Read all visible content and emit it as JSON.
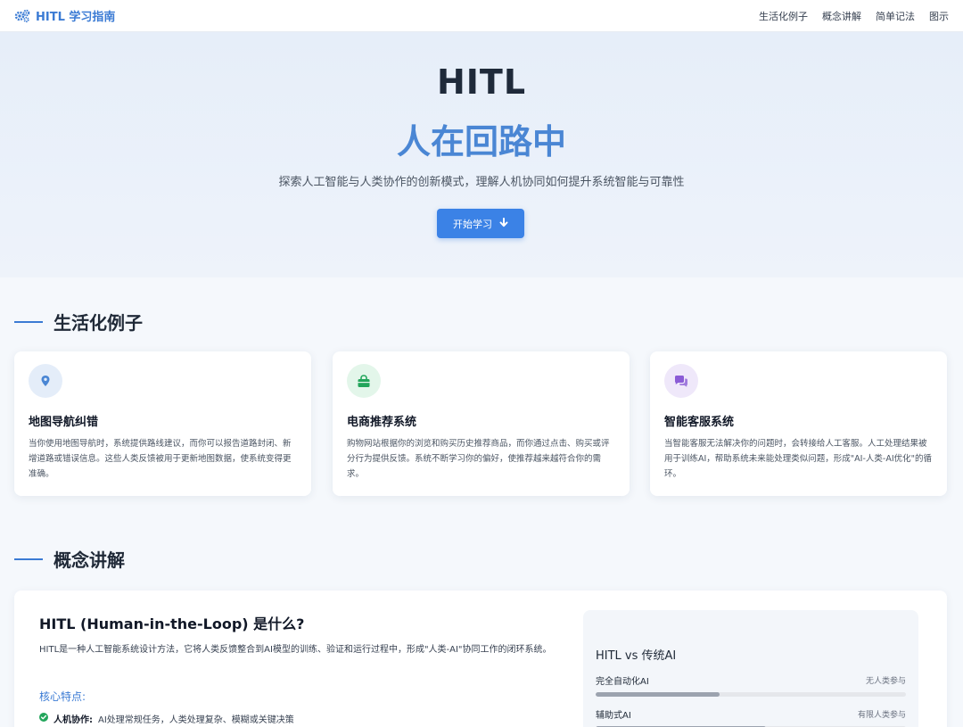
{
  "nav": {
    "brand": "HITL 学习指南",
    "links": [
      "生活化例子",
      "概念讲解",
      "简单记法",
      "图示"
    ]
  },
  "hero": {
    "title": "HITL",
    "subtitle": "人在回路中",
    "description": "探索人工智能与人类协作的创新模式，理解人机协同如何提升系统智能与可靠性",
    "button": "开始学习"
  },
  "examples": {
    "heading": "生活化例子",
    "cards": [
      {
        "icon": "map-pin-icon",
        "icon_color": "#4a86d4",
        "icon_bg": "#e4edf9",
        "title": "地图导航纠错",
        "text": "当你使用地图导航时，系统提供路线建议，而你可以报告道路封闭、新增道路或错误信息。这些人类反馈被用于更新地图数据，使系统变得更准确。"
      },
      {
        "icon": "shopping-bag-icon",
        "icon_color": "#22a55b",
        "icon_bg": "#e3f6ea",
        "title": "电商推荐系统",
        "text": "购物网站根据你的浏览和购买历史推荐商品，而你通过点击、购买或评分行为提供反馈。系统不断学习你的偏好，使推荐越来越符合你的需求。"
      },
      {
        "icon": "chat-bubbles-icon",
        "icon_color": "#8b5cd6",
        "icon_bg": "#efe8fa",
        "title": "智能客服系统",
        "text": "当智能客服无法解决你的问题时，会转接给人工客服。人工处理结果被用于训练AI，帮助系统未来能处理类似问题，形成\"AI-人类-AI优化\"的循环。"
      }
    ]
  },
  "concepts": {
    "heading": "概念讲解",
    "title": "HITL (Human-in-the-Loop) 是什么?",
    "description": "HITL是一种人工智能系统设计方法，它将人类反馈整合到AI模型的训练、验证和运行过程中，形成\"人类-AI\"协同工作的闭环系统。",
    "features_label": "核心特点:",
    "features": [
      {
        "name": "人机协作:",
        "text": "AI处理常规任务，人类处理复杂、模糊或关键决策"
      }
    ],
    "compare": {
      "title": "HITL vs 传统AI",
      "rows": [
        {
          "name": "完全自动化AI",
          "note": "无人类参与",
          "level": 0.4
        },
        {
          "name": "辅助式AI",
          "note": "有限人类参与",
          "level": 0.55
        }
      ]
    }
  }
}
